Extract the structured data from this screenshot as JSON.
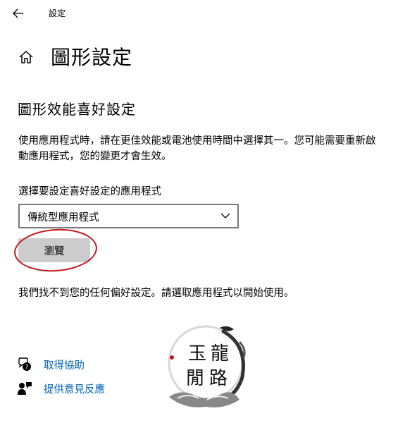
{
  "window": {
    "title": "設定"
  },
  "page": {
    "title": "圖形設定"
  },
  "section": {
    "title": "圖形效能喜好設定",
    "description": "使用應用程式時，請在更佳效能或電池使用時間中選擇其一。您可能需要重新啟動應用程式，您的變更才會生效。"
  },
  "app_select": {
    "label": "選擇要設定喜好設定的應用程式",
    "value": "傳統型應用程式",
    "browse_label": "瀏覽"
  },
  "empty_message": "我們找不到您的任何偏好設定。請選取應用程式以開始使用。",
  "links": {
    "help": {
      "label": "取得協助",
      "icon": "help-chat-icon"
    },
    "feedback": {
      "label": "提供意見反應",
      "icon": "feedback-person-icon"
    }
  },
  "watermark": {
    "text": "玉龍閒路"
  },
  "colors": {
    "link": "#0063b1",
    "button": "#cccccc",
    "annotation": "#c4161c"
  }
}
